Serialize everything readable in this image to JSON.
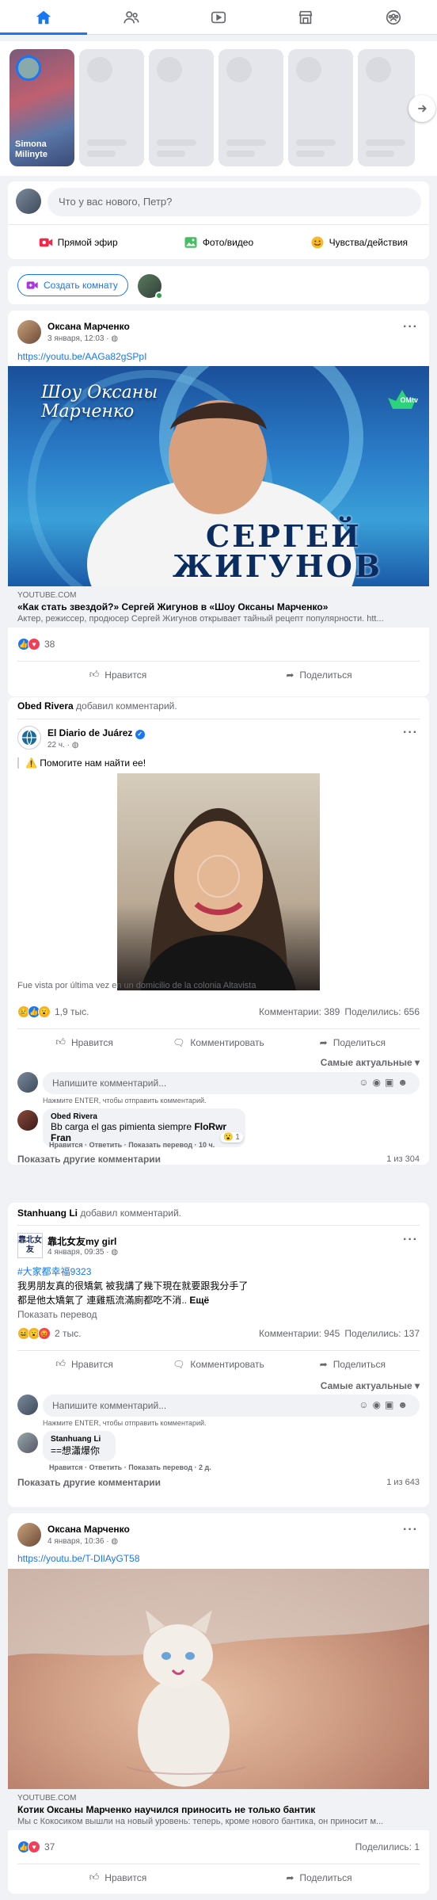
{
  "nav": {
    "tabs": [
      "home-icon",
      "friends-icon",
      "watch-icon",
      "marketplace-icon",
      "groups-icon"
    ],
    "active": "home-icon",
    "accent": "#1877f2"
  },
  "stories": {
    "first_name": "Simona Milinyte"
  },
  "composer": {
    "placeholder": "Что у вас нового, Петр?",
    "live": "Прямой эфир",
    "photo": "Фото/видео",
    "feeling": "Чувства/действия"
  },
  "room": {
    "create": "Создать комнату"
  },
  "post1": {
    "author": "Оксана Марченко",
    "time": "3 января, 12:03 · ",
    "link": "https://youtu.be/AAGa82gSPpI",
    "image_text_top": "Шоу Оксаны Марченко",
    "image_text_name1": "СЕРГЕЙ",
    "image_text_name2": "ЖИГУНОВ",
    "image_brand": "OMtv",
    "source": "YOUTUBE.COM",
    "title": "«Как стать звездой?» Сергей Жигунов в «Шоу Оксаны Марченко»",
    "desc": "Актер, режиссер, продюсер Сергей Жигунов открывает тайный рецепт популярности. htt...",
    "reactions": "38",
    "like": "Нравится",
    "share": "Поделиться"
  },
  "post2": {
    "activity_user": "Obed Rivera",
    "activity_text": "добавил комментарий.",
    "page": "El Diario de Juárez",
    "time": "22 ч. · ",
    "text": "⚠️ Помогите нам найти ее!",
    "caption": "Fue vista por última vez en un domicilio de la colonia Altavista",
    "reactions": "1,9 тыс.",
    "comments": "Комментарии: 389",
    "shares": "Поделились: 656",
    "like": "Нравится",
    "comment": "Комментировать",
    "share": "Поделиться",
    "sort": "Самые актуальные",
    "input": "Напишите комментарий...",
    "hint": "Нажмите ENTER, чтобы отправить комментарий.",
    "c_author": "Obed Rivera",
    "c_text": "Bb carga el gas pimienta siempre ",
    "c_tag": "FloRwr Fran",
    "c_reply_count": "1",
    "c_links": "Нравится · Ответить · Показать перевод · 10 ч.",
    "more": "Показать другие комментарии",
    "count": "1 из 304"
  },
  "post3": {
    "activity_user": "Stanhuang Li",
    "activity_text": "добавил комментарий.",
    "page": "靠北女友my girl",
    "page_logo": "靠北女友",
    "time": "4 января, 09:35 · ",
    "hashtag": "#大家都幸福9323",
    "line1": "我男朋友真的很矯氣 被我講了幾下現在就要跟我分手了",
    "line2": "都是他太矯氣了 連雞瓶流滿廁都吃不消.. ",
    "more": "Ещё",
    "translate": "Показать перевод",
    "reactions": "2 тыс.",
    "comments": "Комментарии: 945",
    "shares": "Поделились: 137",
    "like": "Нравится",
    "comment": "Комментировать",
    "share": "Поделиться",
    "sort": "Самые актуальные",
    "input": "Напишите комментарий...",
    "hint": "Нажмите ENTER, чтобы отправить комментарий.",
    "c_author": "Stanhuang Li",
    "c_text": "==想瀟爆你",
    "c_links": "Нравится · Ответить · Показать перевод · 2 д.",
    "more_c": "Показать другие комментарии",
    "count": "1 из 643"
  },
  "post4": {
    "author": "Оксана Марченко",
    "time": "4 января, 10:36 · ",
    "link": "https://youtu.be/T-DIlAyGT58",
    "source": "YOUTUBE.COM",
    "title": "Котик Оксаны Марченко научился приносить не только бантик",
    "desc": "Мы с Кокосиком вышли на новый уровень: теперь, кроме нового бантика, он приносит м...",
    "reactions": "37",
    "shares": "Поделились: 1",
    "like": "Нравится",
    "share": "Поделиться"
  }
}
